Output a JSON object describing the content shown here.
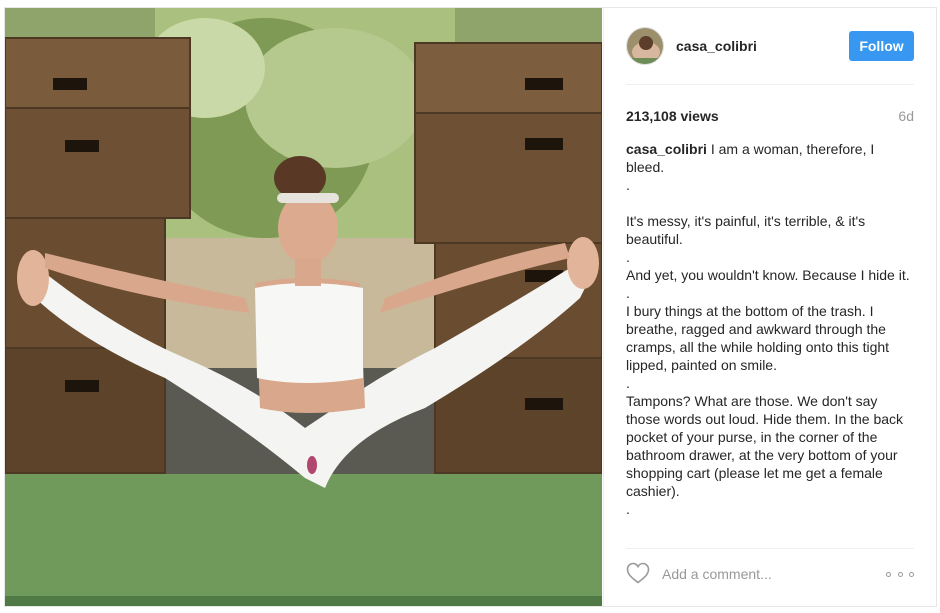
{
  "post": {
    "username": "casa_colibri",
    "follow_label": "Follow",
    "views": "213,108 views",
    "age": "6d",
    "caption_author": "casa_colibri",
    "caption_first": " I am a woman, therefore, I bleed.",
    "caption_lines": [
      ".",
      "",
      "It's messy, it's painful, it's terrible, & it's beautiful.",
      ".",
      "And yet, you wouldn't know. Because I hide it.",
      ".",
      "I bury things at the bottom of the trash. I breathe, ragged and awkward through the cramps, all the while holding onto this tight lipped, painted on smile.",
      ".",
      "Tampons? What are those. We don't say those words out loud. Hide them. In the back pocket of your purse, in the corner of the bathroom drawer, at the very bottom of your shopping cart (please let me get a female cashier).",
      "."
    ],
    "comment_placeholder": "Add a comment...",
    "accent_color": "#3897f0"
  },
  "media": {
    "description_icon": "photo"
  }
}
